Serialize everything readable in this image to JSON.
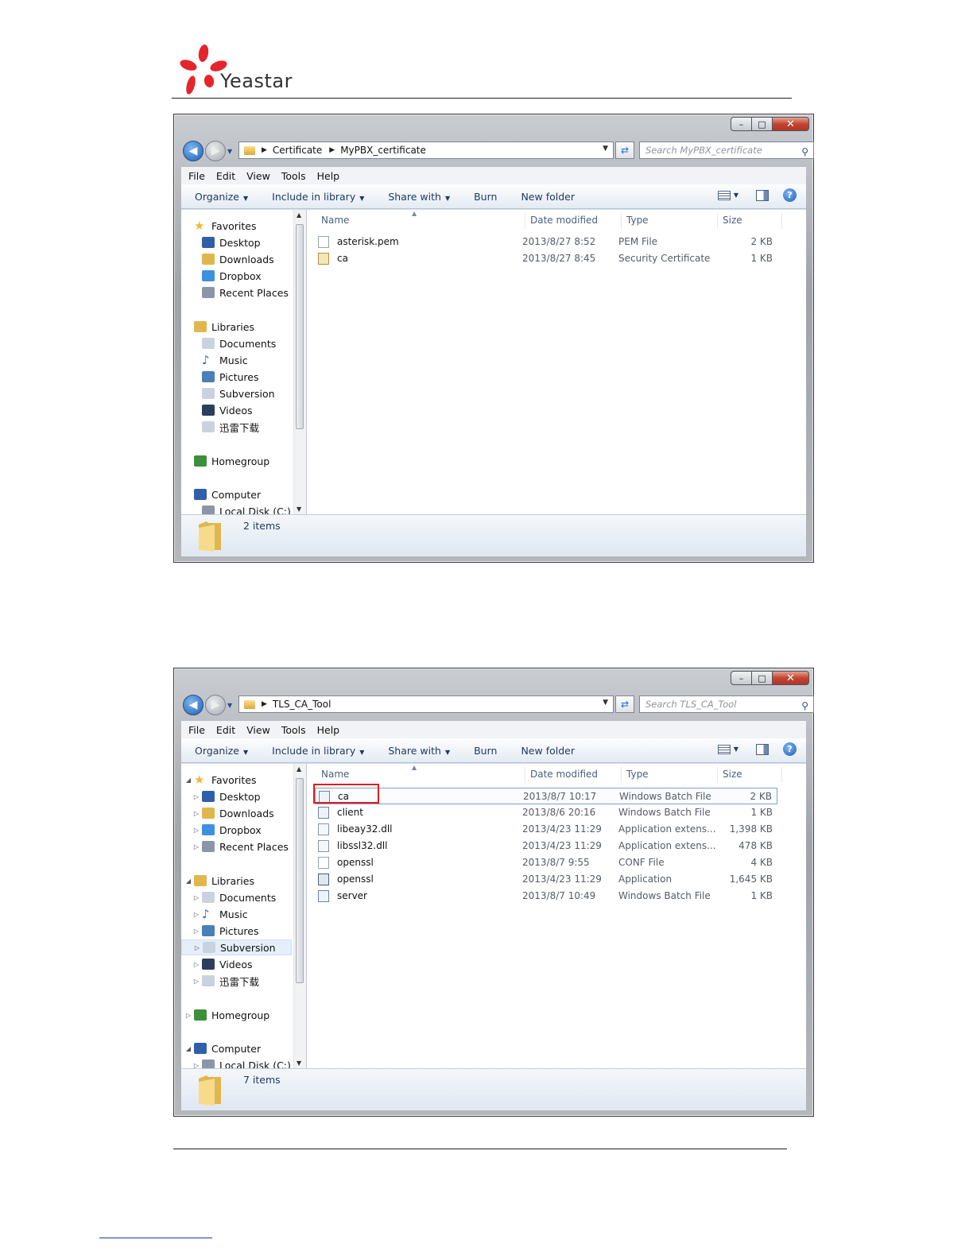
{
  "brand": {
    "name": "Yeastar",
    "logo_color": "#e5242b"
  },
  "windows": [
    {
      "breadcrumb": [
        "Certificate",
        "MyPBX_certificate"
      ],
      "search_placeholder": "Search MyPBX_certificate",
      "menu": [
        "File",
        "Edit",
        "View",
        "Tools",
        "Help"
      ],
      "commands": [
        "Organize",
        "Include in library",
        "Share with",
        "Burn",
        "New folder"
      ],
      "nav": [
        {
          "label": "Favorites",
          "icon": "star-icon",
          "level": 0
        },
        {
          "label": "Desktop",
          "icon": "desktop-icon",
          "level": 1
        },
        {
          "label": "Downloads",
          "icon": "downloads-icon",
          "level": 1
        },
        {
          "label": "Dropbox",
          "icon": "dropbox-icon",
          "level": 1
        },
        {
          "label": "Recent Places",
          "icon": "recent-places-icon",
          "level": 1
        },
        {
          "label": "Libraries",
          "icon": "libraries-icon",
          "level": 0
        },
        {
          "label": "Documents",
          "icon": "documents-icon",
          "level": 1
        },
        {
          "label": "Music",
          "icon": "music-icon",
          "level": 1
        },
        {
          "label": "Pictures",
          "icon": "pictures-icon",
          "level": 1
        },
        {
          "label": "Subversion",
          "icon": "subversion-icon",
          "level": 1
        },
        {
          "label": "Videos",
          "icon": "videos-icon",
          "level": 1
        },
        {
          "label": "迅雷下载",
          "icon": "folder-icon",
          "level": 1
        },
        {
          "label": "Homegroup",
          "icon": "homegroup-icon",
          "level": 0
        },
        {
          "label": "Computer",
          "icon": "computer-icon",
          "level": 0
        },
        {
          "label": "Local Disk (C:)",
          "icon": "disk-icon",
          "level": 1
        }
      ],
      "columns": {
        "name": "Name",
        "date": "Date modified",
        "type": "Type",
        "size": "Size"
      },
      "files": [
        {
          "name": "asterisk.pem",
          "date": "2013/8/27 8:52",
          "type": "PEM File",
          "size": "2 KB",
          "icon": "file-icon"
        },
        {
          "name": "ca",
          "date": "2013/8/27 8:45",
          "type": "Security Certificate",
          "size": "1 KB",
          "icon": "certificate-icon"
        }
      ],
      "status": "2 items"
    },
    {
      "breadcrumb": [
        "TLS_CA_Tool"
      ],
      "search_placeholder": "Search TLS_CA_Tool",
      "menu": [
        "File",
        "Edit",
        "View",
        "Tools",
        "Help"
      ],
      "commands": [
        "Organize",
        "Include in library",
        "Share with",
        "Burn",
        "New folder"
      ],
      "nav": [
        {
          "label": "Favorites",
          "icon": "star-icon",
          "level": 0
        },
        {
          "label": "Desktop",
          "icon": "desktop-icon",
          "level": 1
        },
        {
          "label": "Downloads",
          "icon": "downloads-icon",
          "level": 1
        },
        {
          "label": "Dropbox",
          "icon": "dropbox-icon",
          "level": 1
        },
        {
          "label": "Recent Places",
          "icon": "recent-places-icon",
          "level": 1
        },
        {
          "label": "Libraries",
          "icon": "libraries-icon",
          "level": 0
        },
        {
          "label": "Documents",
          "icon": "documents-icon",
          "level": 1
        },
        {
          "label": "Music",
          "icon": "music-icon",
          "level": 1
        },
        {
          "label": "Pictures",
          "icon": "pictures-icon",
          "level": 1
        },
        {
          "label": "Subversion",
          "icon": "subversion-icon",
          "level": 1
        },
        {
          "label": "Videos",
          "icon": "videos-icon",
          "level": 1
        },
        {
          "label": "迅雷下载",
          "icon": "folder-icon",
          "level": 1
        },
        {
          "label": "Homegroup",
          "icon": "homegroup-icon",
          "level": 0
        },
        {
          "label": "Computer",
          "icon": "computer-icon",
          "level": 0
        },
        {
          "label": "Local Disk (C:)",
          "icon": "disk-icon",
          "level": 1
        }
      ],
      "columns": {
        "name": "Name",
        "date": "Date modified",
        "type": "Type",
        "size": "Size"
      },
      "files": [
        {
          "name": "ca",
          "date": "2013/8/7 10:17",
          "type": "Windows Batch File",
          "size": "2 KB",
          "icon": "batch-file-icon",
          "highlighted": true
        },
        {
          "name": "client",
          "date": "2013/8/6 20:16",
          "type": "Windows Batch File",
          "size": "1 KB",
          "icon": "batch-file-icon"
        },
        {
          "name": "libeay32.dll",
          "date": "2013/4/23 11:29",
          "type": "Application extens...",
          "size": "1,398 KB",
          "icon": "dll-file-icon"
        },
        {
          "name": "libssl32.dll",
          "date": "2013/4/23 11:29",
          "type": "Application extens...",
          "size": "478 KB",
          "icon": "dll-file-icon"
        },
        {
          "name": "openssl",
          "date": "2013/8/7 9:55",
          "type": "CONF File",
          "size": "4 KB",
          "icon": "conf-file-icon"
        },
        {
          "name": "openssl",
          "date": "2013/4/23 11:29",
          "type": "Application",
          "size": "1,645 KB",
          "icon": "application-icon"
        },
        {
          "name": "server",
          "date": "2013/8/7 10:49",
          "type": "Windows Batch File",
          "size": "1 KB",
          "icon": "batch-file-icon"
        }
      ],
      "status": "7 items"
    }
  ]
}
